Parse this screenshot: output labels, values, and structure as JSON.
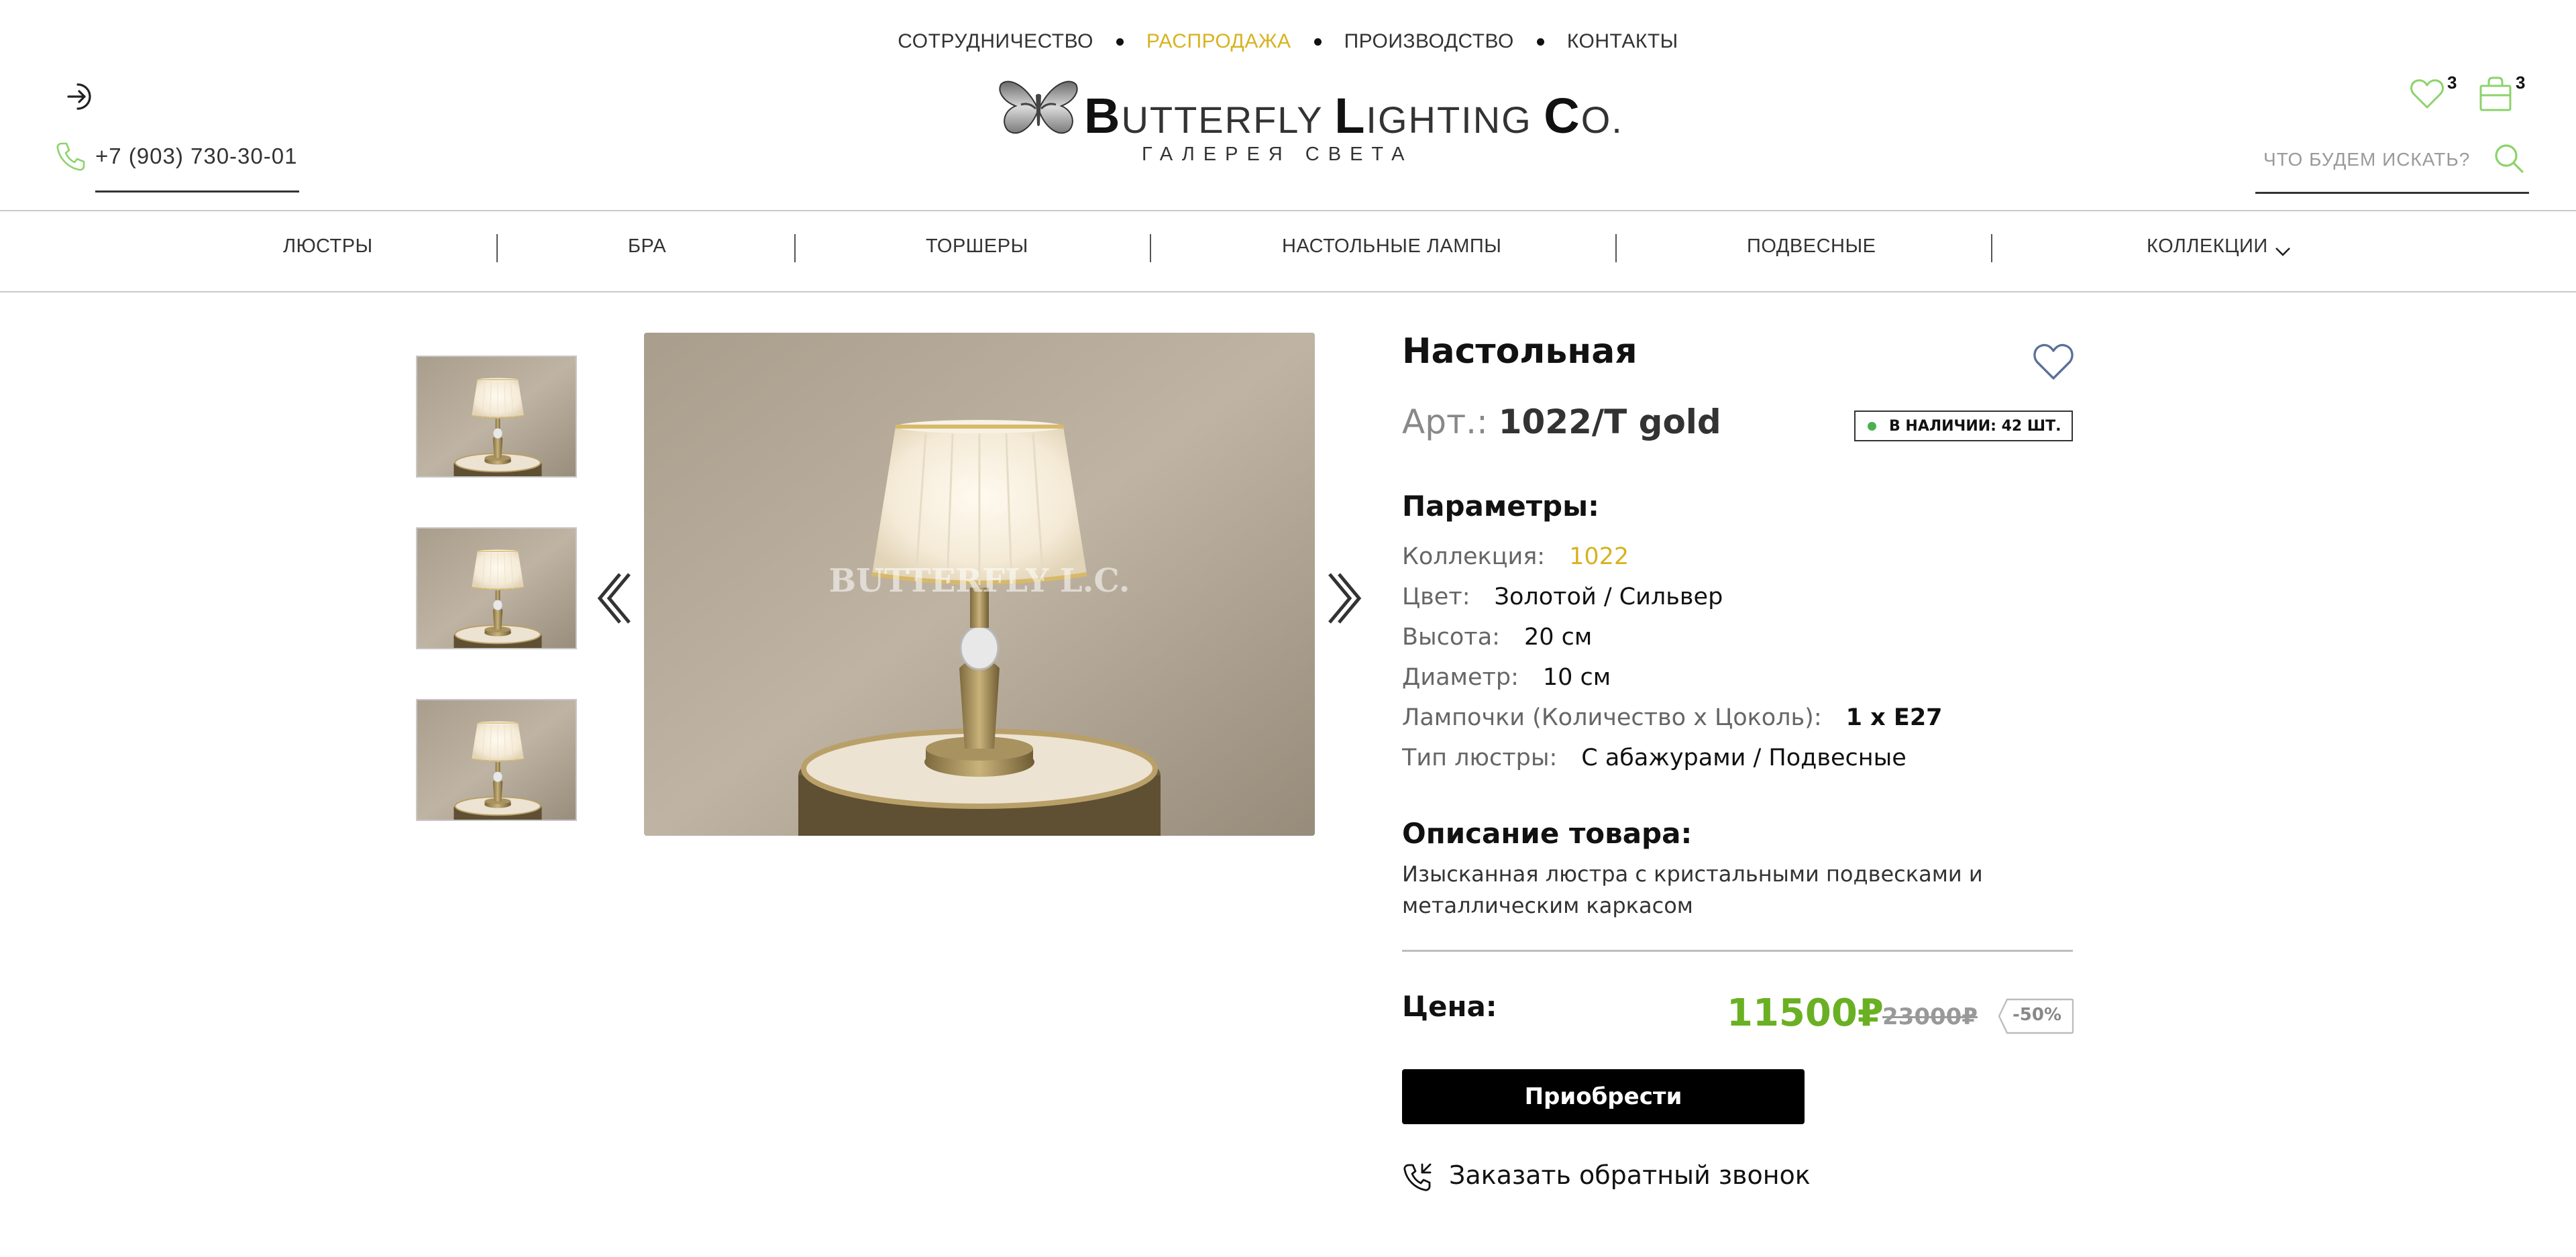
{
  "topnav": {
    "items": [
      "СОТРУДНИЧЕСТВО",
      "РАСПРОДАЖА",
      "ПРОИЗВОДСТВО",
      "КОНТАКТЫ"
    ]
  },
  "header": {
    "phone": "+7 (903) 730-30-01",
    "logo_title_parts": [
      "B",
      "UTTERFLY ",
      "L",
      "IGHTING ",
      "C",
      "O."
    ],
    "logo_subtitle": "ГАЛЕРЕЯ СВЕТА",
    "favorites_count": "3",
    "cart_count": "3",
    "search_placeholder": "ЧТО БУДЕМ ИСКАТЬ?",
    "accent_color": "#8bd36a"
  },
  "catnav": {
    "items": [
      "ЛЮСТРЫ",
      "БРА",
      "ТОРШЕРЫ",
      "НАСТОЛЬНЫЕ ЛАМПЫ",
      "ПОДВЕСНЫЕ",
      "КОЛЛЕКЦИИ"
    ]
  },
  "gallery": {
    "watermark": "BUTTERFLY L.C."
  },
  "product": {
    "title": "Настольная",
    "article_label": "Арт.:",
    "article_value": "1022/T gold",
    "stock": "В НАЛИЧИИ: 42 ШТ.",
    "params_heading": "Параметры:",
    "params": [
      {
        "key": "Коллекция:",
        "value": "1022"
      },
      {
        "key": "Цвет:",
        "value": "Золотой / Сильвер"
      },
      {
        "key": "Высота:",
        "value": "20 см"
      },
      {
        "key": "Диаметр:",
        "value": "10 см"
      },
      {
        "key": "Лампочки (Количество x Цоколь):",
        "value": "1 x E27"
      },
      {
        "key": "Тип люстры:",
        "value": "С абажурами / Подвесные"
      }
    ],
    "desc_heading": "Описание товара:",
    "description": "Изысканная люстра с кристальными подвесками и металлическим каркасом",
    "price_label": "Цена:",
    "price_new": "11500₽",
    "price_old": "23000₽",
    "discount": "-50%",
    "buy_label": "Приобрести",
    "callback_label": "Заказать обратный звонок",
    "colors": {
      "gold": "#d7b320",
      "price_green": "#6ab023",
      "stock_dot": "#4caf50"
    }
  }
}
